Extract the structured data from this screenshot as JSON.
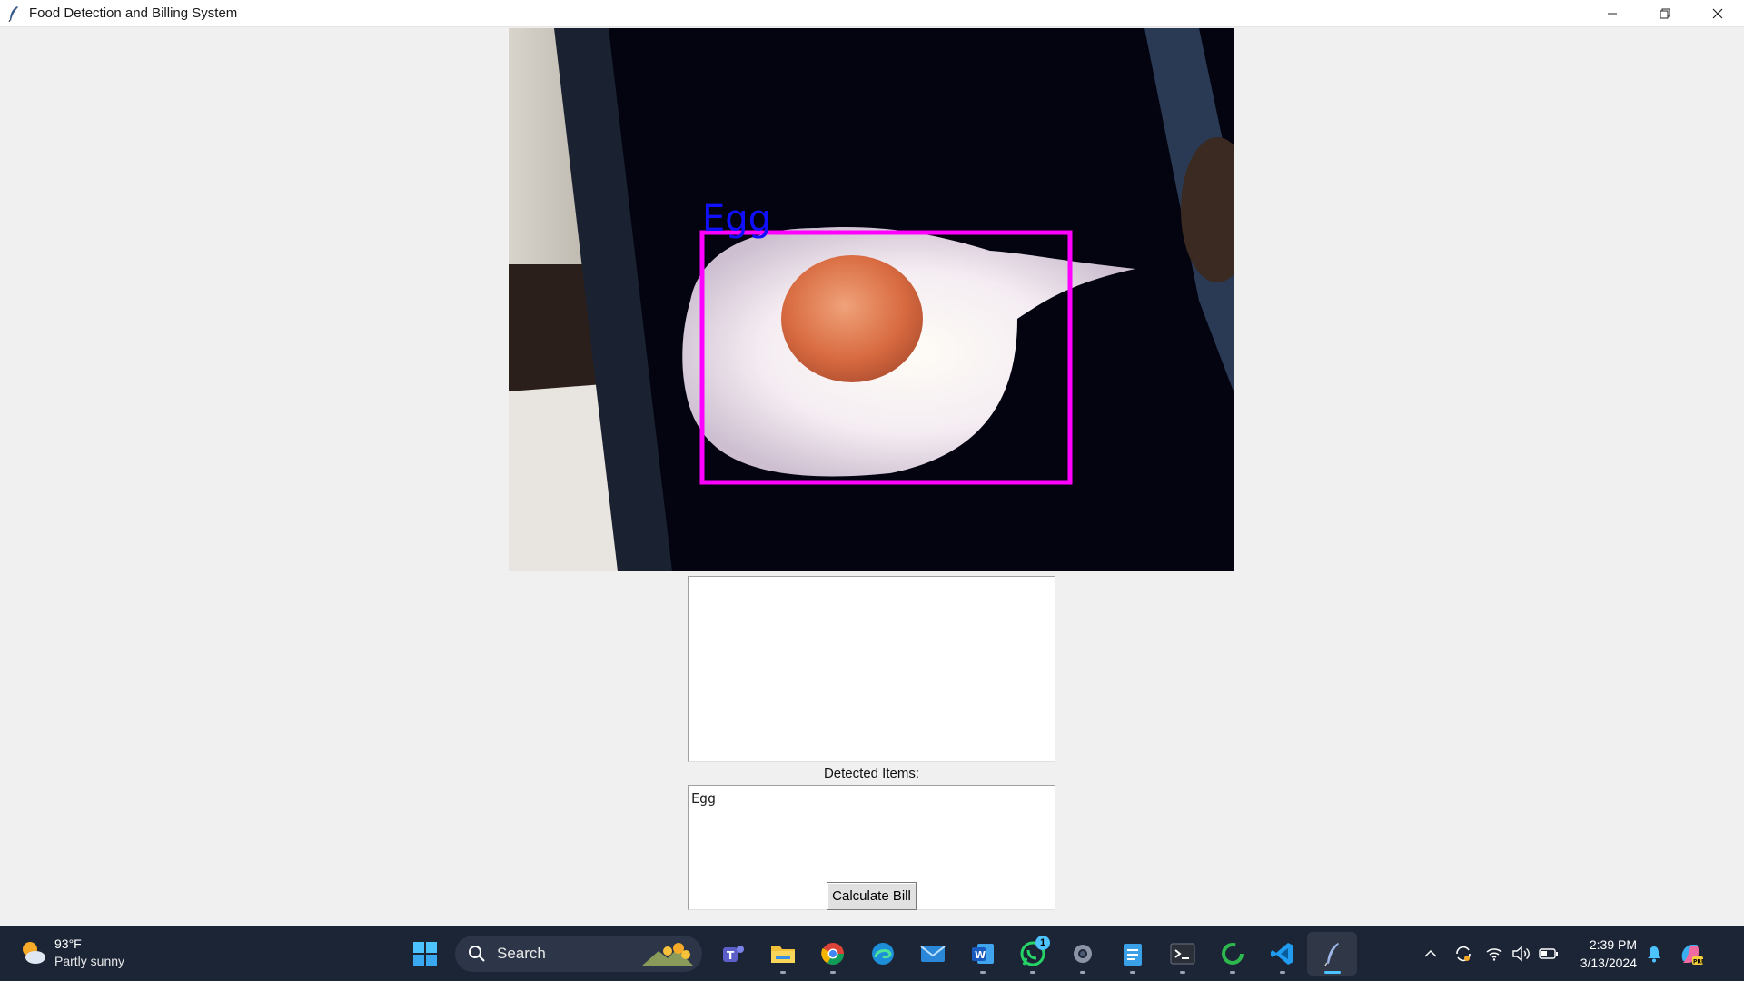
{
  "window": {
    "title": "Food Detection and Billing System",
    "controls": [
      "minimize",
      "restore",
      "close"
    ]
  },
  "camera": {
    "detection_label": "Egg",
    "box_color": "#ff00ff",
    "label_color": "#1010ff"
  },
  "detected_items": {
    "label": "Detected Items:",
    "value": "Egg"
  },
  "buttons": {
    "calculate_bill": "Calculate Bill"
  },
  "taskbar": {
    "weather": {
      "temp": "93°F",
      "condition": "Partly sunny"
    },
    "search_placeholder": "Search",
    "whatsapp_badge": "1",
    "apps": [
      "start-icon",
      "search",
      "teams-icon",
      "file-explorer-icon",
      "chrome-icon",
      "edge-icon",
      "mail-icon",
      "word-icon",
      "whatsapp-icon",
      "settings-icon",
      "notepad-icon",
      "terminal-icon",
      "loading-icon",
      "vscode-icon",
      "tkinter-feather-icon"
    ],
    "clock": {
      "time": "2:39 PM",
      "date": "3/13/2024"
    }
  }
}
